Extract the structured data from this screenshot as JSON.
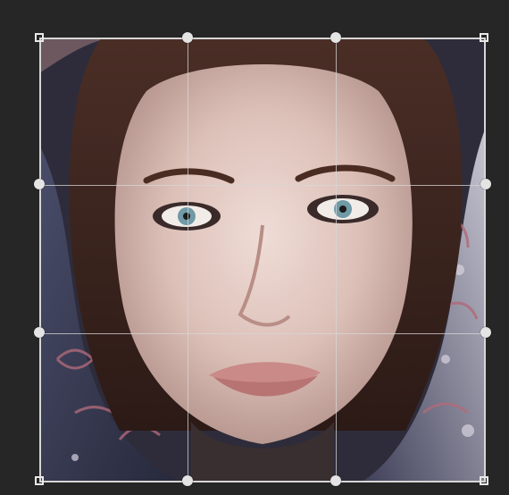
{
  "canvas": {
    "background": "#262626",
    "image_subject": "portrait"
  },
  "crop_overlay": {
    "grid": "rule-of-thirds",
    "border_color": "#d6d6d6",
    "handle_color": "#e4e4e4"
  }
}
